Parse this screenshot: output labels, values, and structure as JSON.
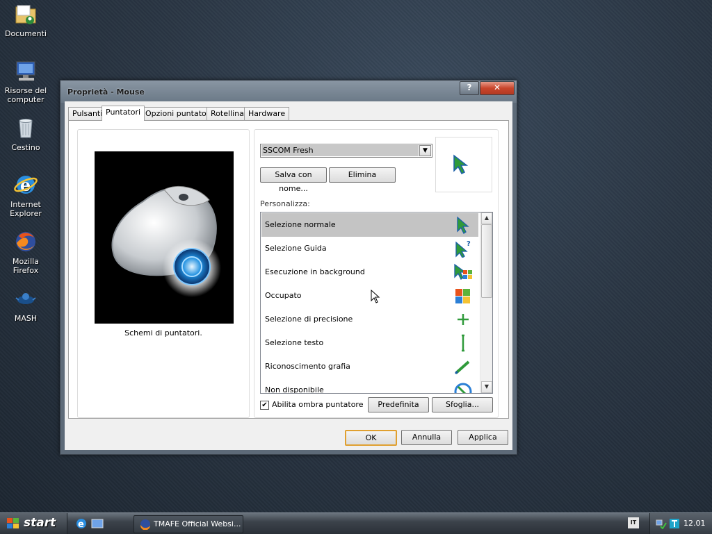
{
  "desktop": {
    "icons": [
      {
        "label": "Documenti",
        "icon": "folder-icon"
      },
      {
        "label": "Risorse del computer",
        "icon": "computer-icon"
      },
      {
        "label": "Cestino",
        "icon": "recycle-bin-icon"
      },
      {
        "label": "Internet Explorer",
        "icon": "internet-explorer-icon"
      },
      {
        "label": "Mozilla Firefox",
        "icon": "firefox-icon"
      },
      {
        "label": "MASH",
        "icon": "mash-icon"
      }
    ]
  },
  "dialog": {
    "title": "Proprietà - Mouse",
    "help_label": "?",
    "close_label": "✕",
    "tabs": [
      {
        "label": "Pulsanti",
        "active": false
      },
      {
        "label": "Puntatori",
        "active": true
      },
      {
        "label": "Opzioni puntatore",
        "active": false
      },
      {
        "label": "Rotellina",
        "active": false
      },
      {
        "label": "Hardware",
        "active": false
      }
    ],
    "preview_caption": "Schemi di puntatori.",
    "scheme": {
      "selected": "SSCOM Fresh"
    },
    "save_as_label": "Salva con nome...",
    "delete_label": "Elimina",
    "customize_label": "Personalizza:",
    "cursors": [
      {
        "label": "Selezione normale",
        "icon": "arrow-cursor-icon",
        "selected": true
      },
      {
        "label": "Selezione Guida",
        "icon": "help-cursor-icon",
        "selected": false
      },
      {
        "label": "Esecuzione in background",
        "icon": "working-background-cursor-icon",
        "selected": false
      },
      {
        "label": "Occupato",
        "icon": "busy-cursor-icon",
        "selected": false
      },
      {
        "label": "Selezione di precisione",
        "icon": "crosshair-cursor-icon",
        "selected": false
      },
      {
        "label": "Selezione testo",
        "icon": "text-cursor-icon",
        "selected": false
      },
      {
        "label": "Riconoscimento grafia",
        "icon": "pen-cursor-icon",
        "selected": false
      },
      {
        "label": "Non disponibile",
        "icon": "unavailable-cursor-icon",
        "selected": false
      }
    ],
    "shadow_checkbox": {
      "label": "Abilita ombra puntatore",
      "checked": true
    },
    "default_label": "Predefinita",
    "browse_label": "Sfoglia...",
    "ok_label": "OK",
    "cancel_label": "Annulla",
    "apply_label": "Applica"
  },
  "taskbar": {
    "start_label": "start",
    "task_label": "TMAFE Official Websi...",
    "language": "IT",
    "clock": "12.01"
  },
  "colors": {
    "cursor_green": "#2f9a3a",
    "cursor_blue": "#2b7fd6",
    "selection_gray": "#c4c4c4",
    "default_button_border": "#e0a030"
  }
}
